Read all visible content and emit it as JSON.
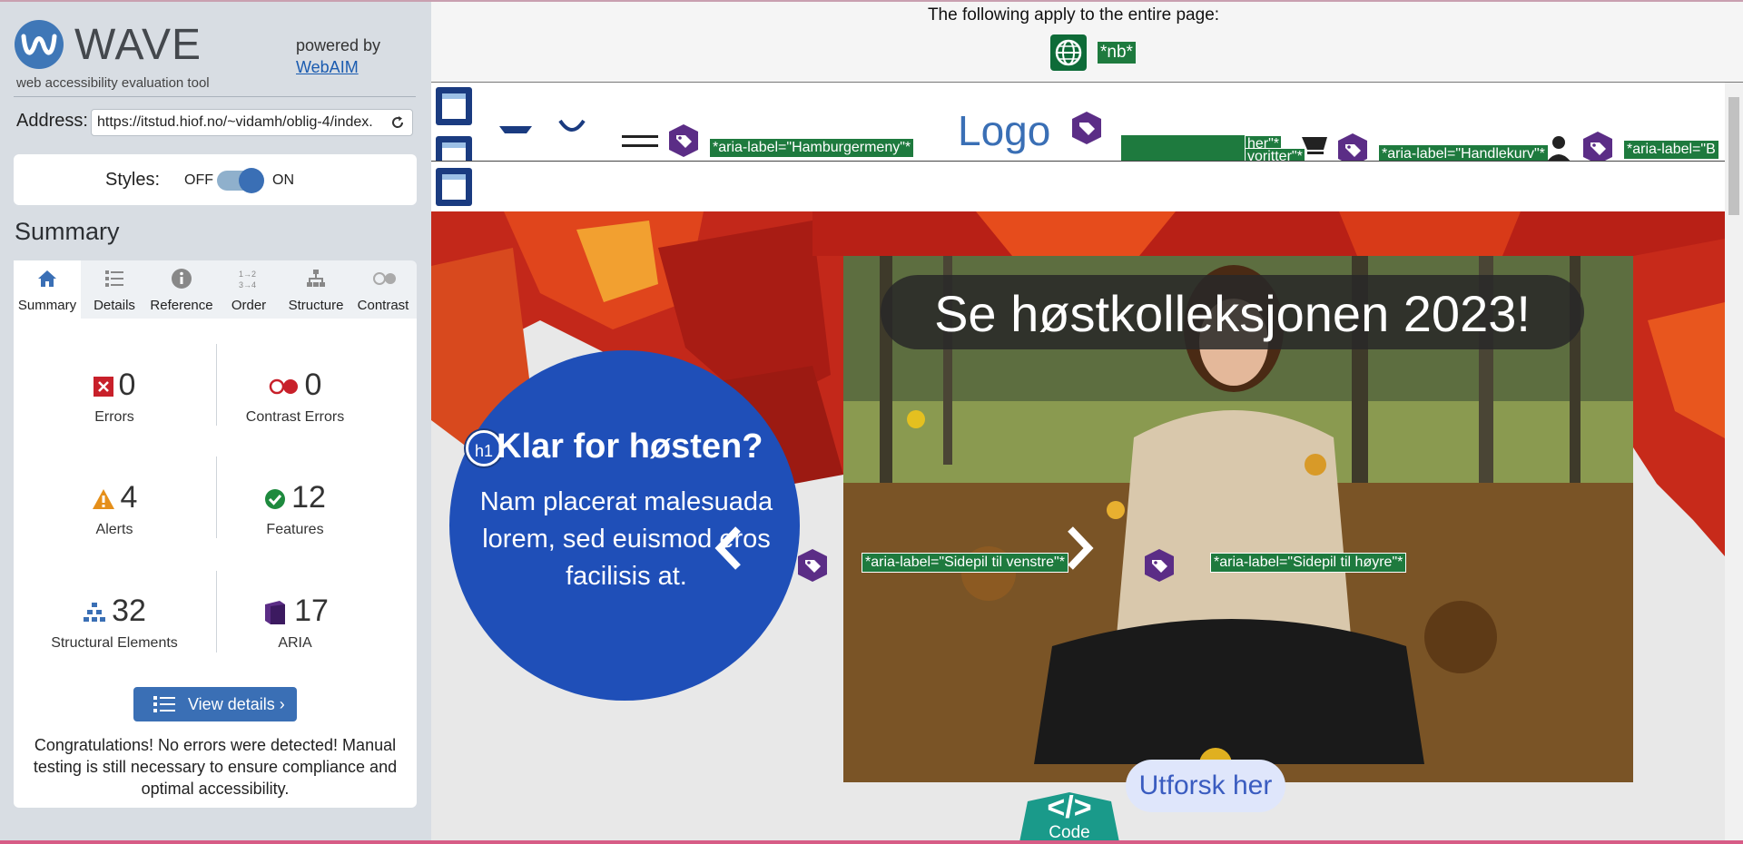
{
  "sidebar": {
    "app_name": "WAVE",
    "subtitle": "web accessibility evaluation tool",
    "powered_by": "powered by",
    "webaim_link": "WebAIM",
    "address_label": "Address:",
    "address_value": "https://itstud.hiof.no/~vidamh/oblig-4/index.",
    "styles_label": "Styles:",
    "styles_off": "OFF",
    "styles_on": "ON",
    "styles_state": "on",
    "summary_heading": "Summary",
    "tabs": [
      {
        "label": "Summary",
        "icon": "home-icon",
        "active": true
      },
      {
        "label": "Details",
        "icon": "list-icon"
      },
      {
        "label": "Reference",
        "icon": "info-icon"
      },
      {
        "label": "Order",
        "icon": "order-icon"
      },
      {
        "label": "Structure",
        "icon": "structure-icon"
      },
      {
        "label": "Contrast",
        "icon": "contrast-icon"
      }
    ],
    "stats": {
      "errors": {
        "count": "0",
        "label": "Errors"
      },
      "contrast_errors": {
        "count": "0",
        "label": "Contrast Errors"
      },
      "alerts": {
        "count": "4",
        "label": "Alerts"
      },
      "features": {
        "count": "12",
        "label": "Features"
      },
      "structural": {
        "count": "32",
        "label": "Structural Elements"
      },
      "aria": {
        "count": "17",
        "label": "ARIA"
      }
    },
    "view_details": "View details ›",
    "congrats": "Congratulations! No errors were detected! Manual testing is still necessary to ensure compliance and optimal accessibility."
  },
  "main": {
    "apply_text": "The following apply to the entire page:",
    "lang_badge": "*nb*",
    "nav_labels": {
      "hamburger": "*aria-label=\"Hamburgermeny\"*",
      "handlekurv": "*aria-label=\"Handlekurv\"*",
      "fav1": "her\"*",
      "fav2": "voritter\"*",
      "b": "*aria-label=\"B"
    },
    "logo_text": "Logo",
    "hero": {
      "title": "Se høstkolleksjonen 2023!",
      "circle_heading": "Klar for høsten?",
      "heading_badge": "h1",
      "circle_text": "Nam placerat malesuada lorem, sed euismod eros facilisis at.",
      "left_arrow_label": "*aria-label=\"Sidepil til venstre\"*",
      "right_arrow_label": "*aria-label=\"Sidepil til høyre\"*",
      "explore_button": "Utforsk her",
      "code_label": "Code",
      "code_symbol": "</>"
    }
  },
  "colors": {
    "wave_blue": "#3a6fb5",
    "feature_green": "#1e7a3e",
    "aria_purple": "#5b2d86",
    "hero_blue": "#1f4fb8"
  }
}
